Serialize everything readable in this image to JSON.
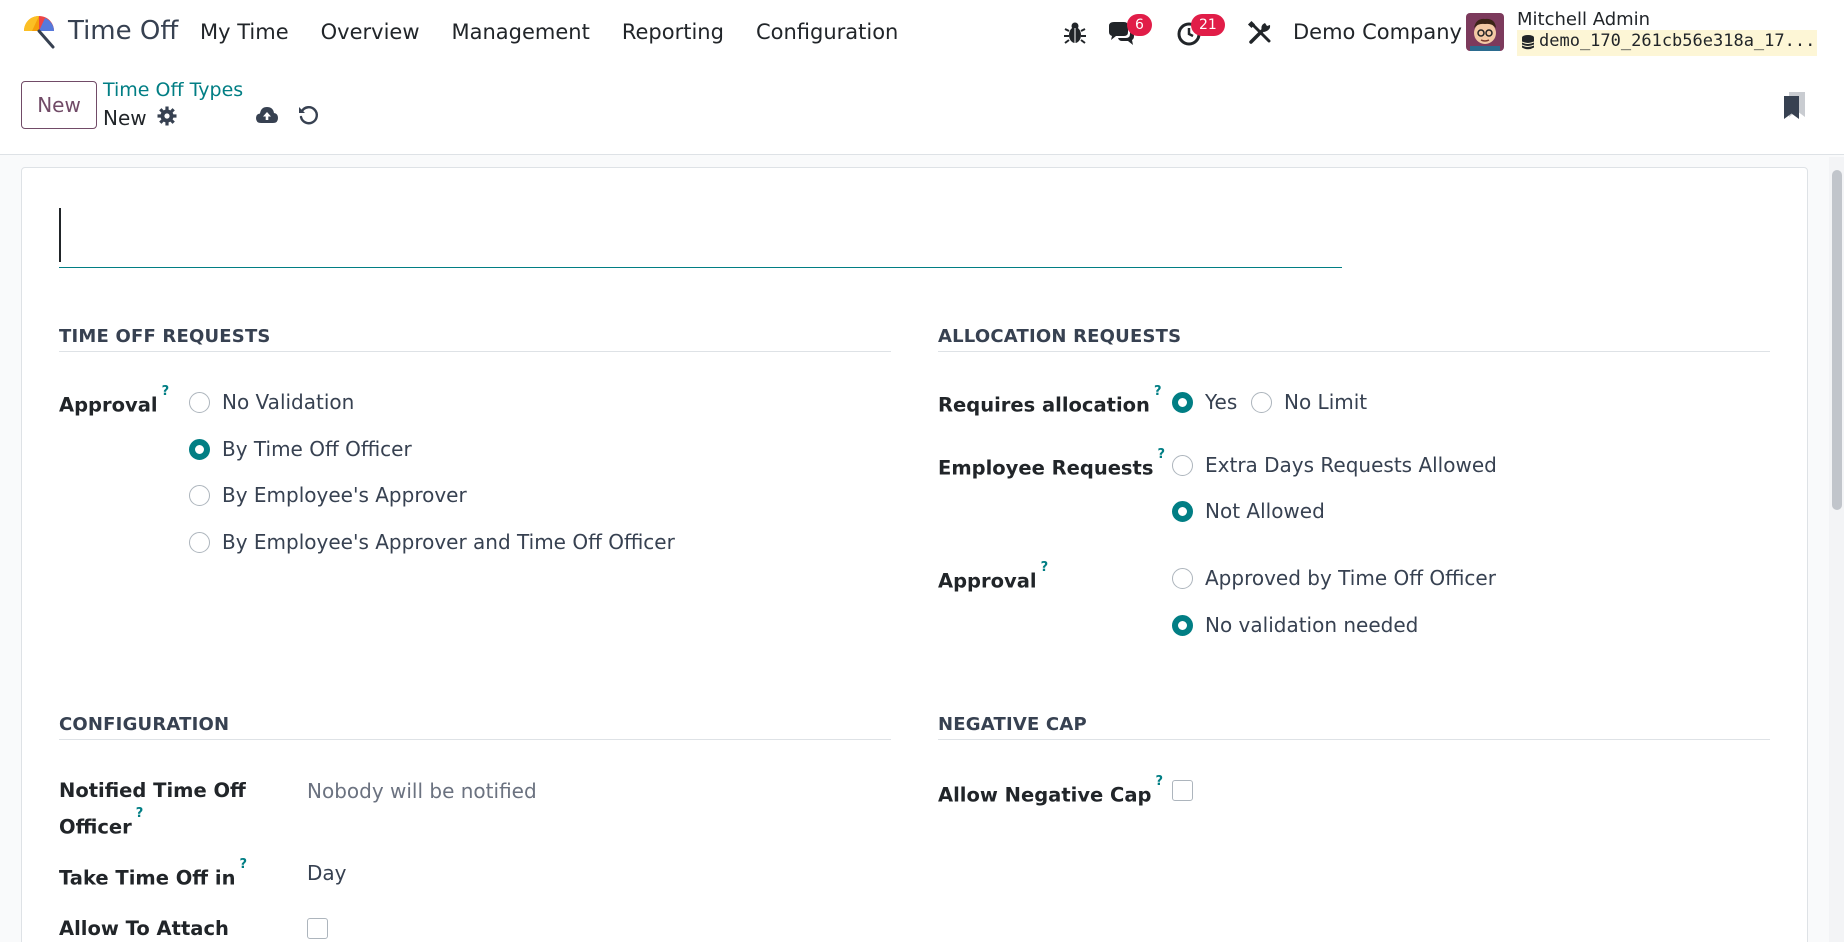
{
  "navbar": {
    "app_name": "Time Off",
    "menu": [
      "My Time",
      "Overview",
      "Management",
      "Reporting",
      "Configuration"
    ],
    "messages_count": "6",
    "activities_count": "21",
    "company": "Demo Company",
    "user_name": "Mitchell Admin",
    "database": "demo_170_261cb56e318a_17..."
  },
  "control_panel": {
    "new_button": "New",
    "breadcrumb": "Time Off Types",
    "record_name": "New"
  },
  "form": {
    "name_value": "",
    "time_off_requests": {
      "title": "TIME OFF REQUESTS",
      "approval_label": "Approval",
      "approval_options": [
        "No Validation",
        "By Time Off Officer",
        "By Employee's Approver",
        "By Employee's Approver and Time Off Officer"
      ],
      "approval_selected": 1
    },
    "allocation_requests": {
      "title": "ALLOCATION REQUESTS",
      "requires_label": "Requires allocation",
      "requires_options": [
        "Yes",
        "No Limit"
      ],
      "employee_requests_label": "Employee Requests",
      "employee_requests_options": [
        "Extra Days Requests Allowed",
        "Not Allowed"
      ],
      "approval_label": "Approval",
      "approval_options": [
        "Approved by Time Off Officer",
        "No validation needed"
      ]
    },
    "configuration": {
      "title": "CONFIGURATION",
      "notified_label_1": "Notified Time Off",
      "notified_label_2": "Officer",
      "notified_value": "Nobody will be notified",
      "take_time_off_label": "Take Time Off in",
      "take_time_off_value": "Day",
      "allow_attach_label": "Allow To Attach"
    },
    "negative_cap": {
      "title": "NEGATIVE CAP",
      "allow_label": "Allow Negative Cap"
    },
    "help_mark": "?"
  },
  "colors": {
    "accent": "#017e84",
    "brand": "#714b67",
    "badge": "#e11d48"
  }
}
